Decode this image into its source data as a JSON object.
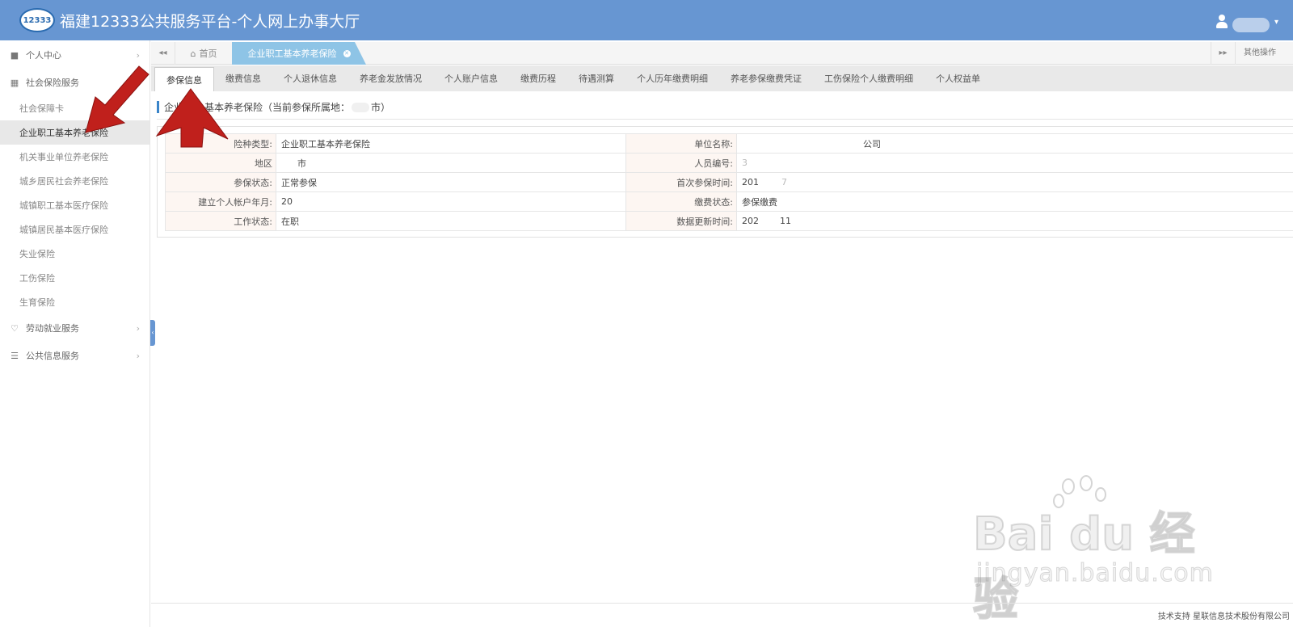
{
  "header": {
    "logo_text": "12333",
    "title": "福建12333公共服务平台-个人网上办事大厅",
    "user_caret": "▾"
  },
  "sidebar": {
    "groups": [
      {
        "label": "个人中心",
        "icon": "user-icon"
      },
      {
        "label": "社会保险服务",
        "icon": "grid-icon"
      },
      {
        "label": "劳动就业服务",
        "icon": "heart-icon"
      },
      {
        "label": "公共信息服务",
        "icon": "list-icon"
      }
    ],
    "social_items": [
      {
        "label": "社会保障卡"
      },
      {
        "label": "企业职工基本养老保险",
        "active": true
      },
      {
        "label": "机关事业单位养老保险"
      },
      {
        "label": "城乡居民社会养老保险"
      },
      {
        "label": "城镇职工基本医疗保险"
      },
      {
        "label": "城镇居民基本医疗保险"
      },
      {
        "label": "失业保险"
      },
      {
        "label": "工伤保险"
      },
      {
        "label": "生育保险"
      }
    ]
  },
  "tabs": {
    "home": "首页",
    "active": "企业职工基本养老保险",
    "other_ops": "其他操作"
  },
  "subtabs": [
    {
      "label": "参保信息",
      "active": true
    },
    {
      "label": "缴费信息"
    },
    {
      "label": "个人退休信息"
    },
    {
      "label": "养老金发放情况"
    },
    {
      "label": "个人账户信息"
    },
    {
      "label": "缴费历程"
    },
    {
      "label": "待遇测算"
    },
    {
      "label": "个人历年缴费明细"
    },
    {
      "label": "养老参保缴费凭证"
    },
    {
      "label": "工伤保险个人缴费明细"
    },
    {
      "label": "个人权益单"
    }
  ],
  "section": {
    "title_part1": "企业",
    "title_part2": "基本养老保险（当前参保所属地：",
    "title_part3": "市）"
  },
  "info": {
    "rows": [
      {
        "label1": "险种类型:",
        "value1": "企业职工基本养老保险",
        "label2": "单位名称:",
        "value2": "公司"
      },
      {
        "label1": "地区",
        "value1": "市",
        "label2": "人员编号:",
        "value2": "3"
      },
      {
        "label1": "参保状态:",
        "value1": "正常参保",
        "label2": "首次参保时间:",
        "value2": "201"
      },
      {
        "label1": "建立个人帐户年月:",
        "value1": "20",
        "label2": "缴费状态:",
        "value2": "参保缴费"
      },
      {
        "label1": "工作状态:",
        "value1": "在职",
        "label2": "数据更新时间:",
        "value2": "202"
      }
    ],
    "value2_suffix_row3": "7",
    "value2_suffix_row5": "11"
  },
  "watermark": {
    "brand": "Bai du 经验",
    "url": "jingyan.baidu.com"
  },
  "footer": {
    "text": "技术支持 星联信息技术股份有限公司"
  },
  "colors": {
    "header_bg": "#6796d2",
    "active_tab": "#8ec4e6",
    "arrow": "#c0201c",
    "label_bg": "#fdf6f2"
  }
}
